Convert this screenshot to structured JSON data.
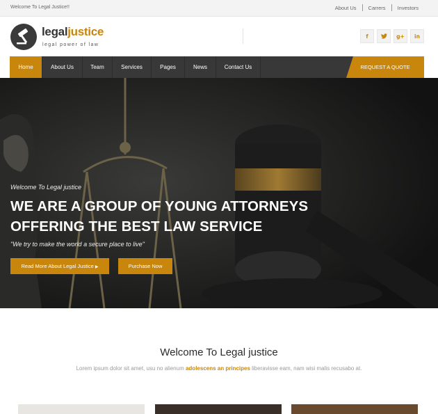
{
  "topbar": {
    "welcome": "Welcome To Legal Justice!!",
    "links": [
      "About Us",
      "Carrers",
      "Investors"
    ]
  },
  "header": {
    "logo_part1": "legal",
    "logo_part2": "justice",
    "tagline": "legal power of law",
    "socials": [
      {
        "icon": "facebook-icon",
        "glyph": "f"
      },
      {
        "icon": "twitter-icon",
        "glyph": "t"
      },
      {
        "icon": "google-plus-icon",
        "glyph": "g+"
      },
      {
        "icon": "linkedin-icon",
        "glyph": "in"
      }
    ]
  },
  "nav": {
    "items": [
      "Home",
      "About Us",
      "Team",
      "Services",
      "Pages",
      "News",
      "Contact Us"
    ],
    "active": "Home",
    "cta": "REQUEST A QUOTE"
  },
  "hero": {
    "kicker": "Welcome To Legal justice",
    "headline_line1": "WE ARE A GROUP OF YOUNG ATTORNEYS",
    "headline_line2": "OFFERING THE BEST LAW SERVICE",
    "quote": "\"We try to make the world a secure place to live\"",
    "button_primary": "Read More About Legal Justice",
    "button_secondary": "Purchase Now"
  },
  "welcome": {
    "title": "Welcome To Legal justice",
    "text_before": "Lorem ipsum dolor sit amet, usu no alienum ",
    "text_highlight": "adolescens an principes",
    "text_after": " liberavisse eam, nam wisi malis recusabo at."
  },
  "colors": {
    "accent": "#c8860d",
    "nav_bg": "#383838",
    "topbar_bg": "#f3f3f3"
  }
}
